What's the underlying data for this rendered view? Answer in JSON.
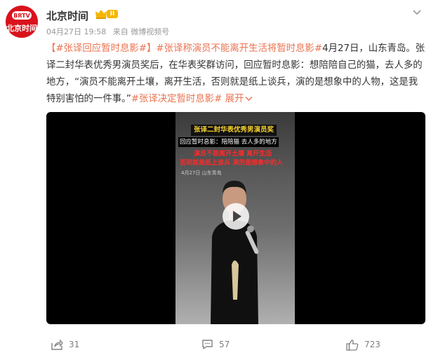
{
  "account": {
    "avatar_label": "北京时间",
    "name": "北京时间",
    "level": "II"
  },
  "meta": {
    "date": "04月27日 19:58",
    "source": "来自 微博视频号"
  },
  "post": {
    "tag1": "【#张译回应暂时息影#】",
    "tag2": "#张译称演员不能离开生活将暂时息影#",
    "body": "4月27日，山东青岛。张译二封华表优秀男演员奖后，在华表奖群访问，回应暂时息影：想陪陪自己的猫，去人多的地方，“演员不能离开土壤，离开生活，否则就是纸上谈兵，演的是想象中的人物，这是我特别害怕的一件事。”",
    "tag3": "#张译决定暂时息影#",
    "expand": "展开"
  },
  "video": {
    "caption1": "张译二封华表优秀男演员奖",
    "caption2": "回应暂时息影：陪陪猫 去人多的地方",
    "caption3": "演员不能离开土壤 离开生活",
    "caption4": "否则就是纸上谈兵 演的是想象中的人",
    "watermark": "4月27日 山东青岛"
  },
  "actions": {
    "share": "31",
    "comment": "57",
    "like": "723"
  }
}
